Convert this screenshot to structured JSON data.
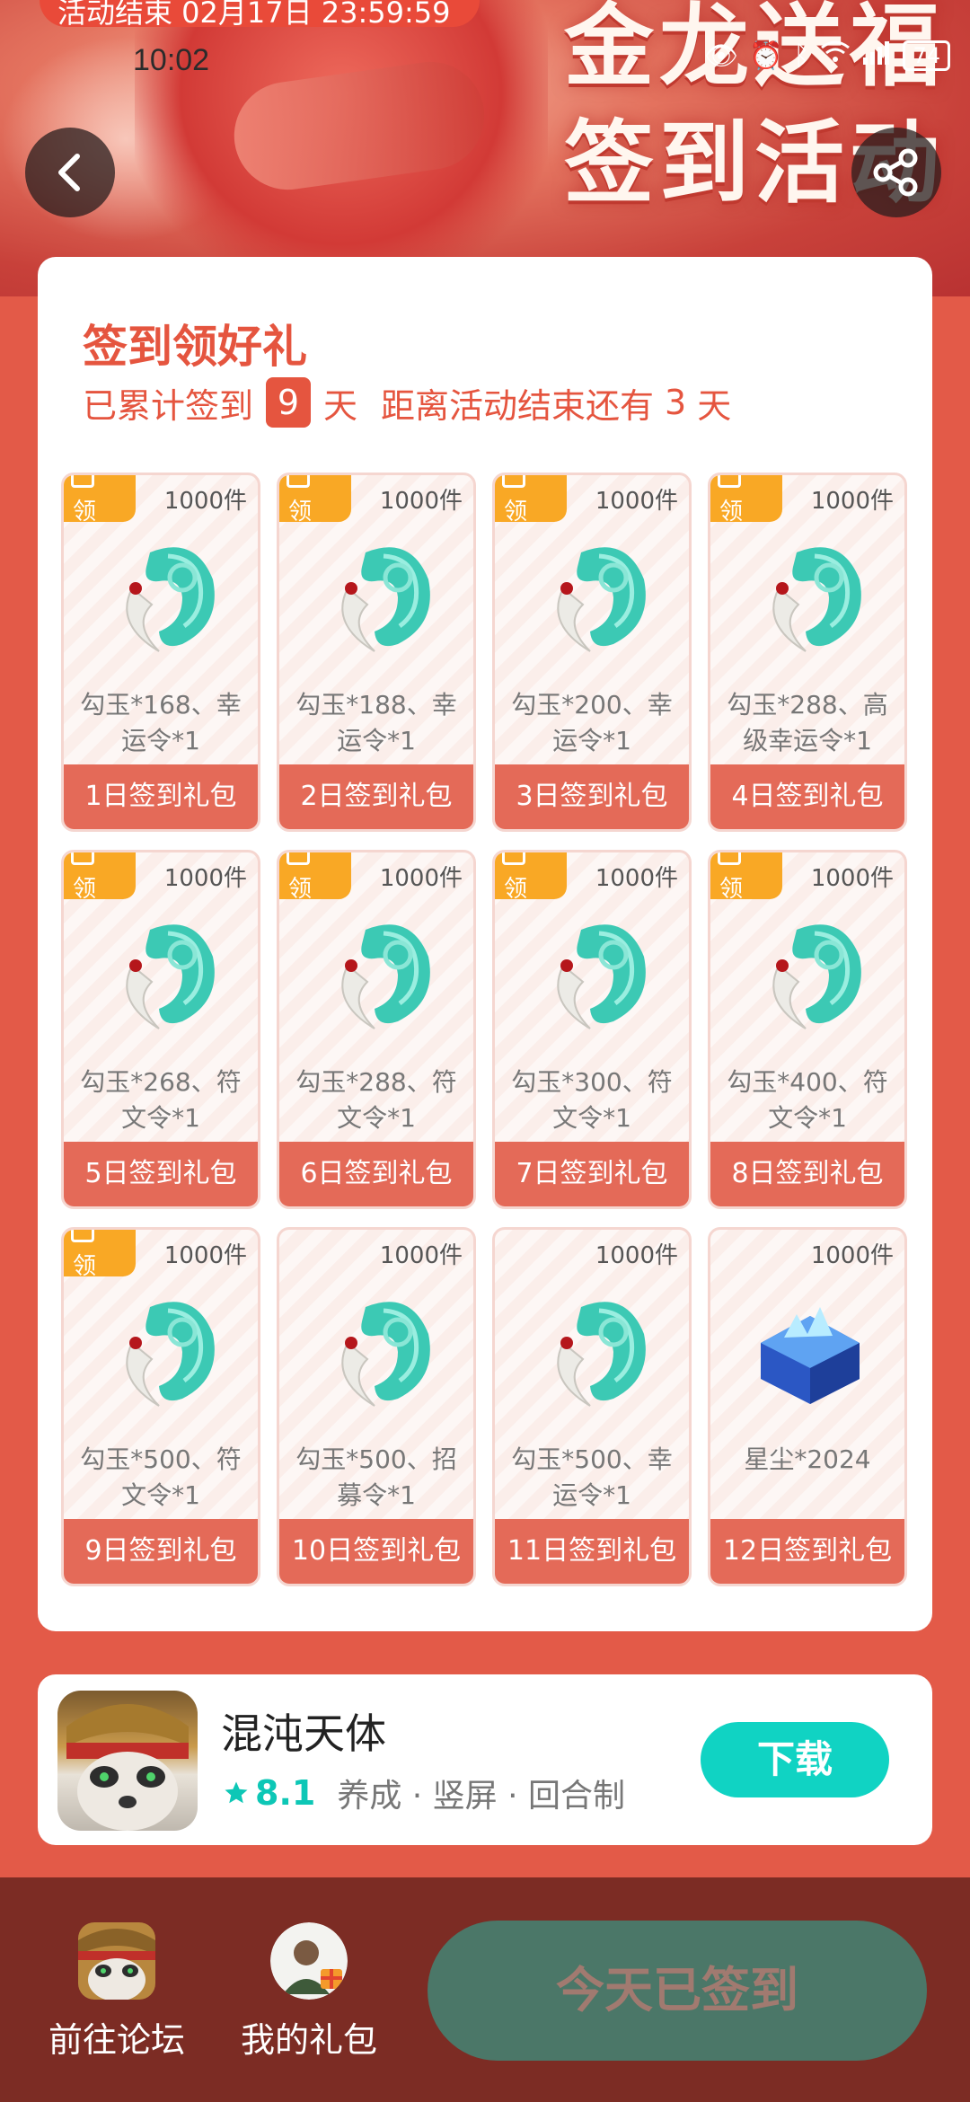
{
  "status_bar": {
    "time": "10:02",
    "battery": "74"
  },
  "banner": {
    "end_notice": "活动结束 02月17日 23:59:59",
    "title_line1": "金龙送福",
    "title_line2": "签到活动"
  },
  "header": {
    "back_icon": "back-arrow-icon",
    "share_icon": "share-icon"
  },
  "card": {
    "title": "签到领好礼",
    "summary": {
      "prefix": "已累计签到",
      "days": "9",
      "days_unit": "天",
      "end_prefix": "距离活动结束还有",
      "end_days": "3",
      "end_unit": "天"
    },
    "gifts": [
      {
        "stock": "1000件",
        "desc": "勾玉*168、幸运令*1",
        "label": "1日签到礼包",
        "tag": "领",
        "icon": "jade-magatama-icon"
      },
      {
        "stock": "1000件",
        "desc": "勾玉*188、幸运令*1",
        "label": "2日签到礼包",
        "tag": "领",
        "icon": "jade-magatama-icon"
      },
      {
        "stock": "1000件",
        "desc": "勾玉*200、幸运令*1",
        "label": "3日签到礼包",
        "tag": "领",
        "icon": "jade-magatama-icon"
      },
      {
        "stock": "1000件",
        "desc": "勾玉*288、高级幸运令*1",
        "label": "4日签到礼包",
        "tag": "领",
        "icon": "jade-magatama-icon"
      },
      {
        "stock": "1000件",
        "desc": "勾玉*268、符文令*1",
        "label": "5日签到礼包",
        "tag": "领",
        "icon": "jade-magatama-icon"
      },
      {
        "stock": "1000件",
        "desc": "勾玉*288、符文令*1",
        "label": "6日签到礼包",
        "tag": "领",
        "icon": "jade-magatama-icon"
      },
      {
        "stock": "1000件",
        "desc": "勾玉*300、符文令*1",
        "label": "7日签到礼包",
        "tag": "领",
        "icon": "jade-magatama-icon"
      },
      {
        "stock": "1000件",
        "desc": "勾玉*400、符文令*1",
        "label": "8日签到礼包",
        "tag": "领",
        "icon": "jade-magatama-icon"
      },
      {
        "stock": "1000件",
        "desc": "勾玉*500、符文令*1",
        "label": "9日签到礼包",
        "tag": "领",
        "icon": "jade-magatama-icon"
      },
      {
        "stock": "1000件",
        "desc": "勾玉*500、招募令*1",
        "label": "10日签到礼包",
        "tag": "",
        "icon": "jade-magatama-icon"
      },
      {
        "stock": "1000件",
        "desc": "勾玉*500、幸运令*1",
        "label": "11日签到礼包",
        "tag": "",
        "icon": "jade-magatama-icon"
      },
      {
        "stock": "1000件",
        "desc": "星尘*2024",
        "label": "12日签到礼包",
        "tag": "",
        "icon": "blue-crystal-chest-icon"
      }
    ]
  },
  "app": {
    "name": "混沌天体",
    "rating": "8.1",
    "tags": "养成 · 竖屏 · 回合制",
    "download_label": "下载",
    "colors": {
      "download": "#10d3c3",
      "rating": "#0dc7b6"
    }
  },
  "bottom_bar": {
    "forum_label": "前往论坛",
    "gifts_label": "我的礼包",
    "signed_label": "今天已签到"
  }
}
